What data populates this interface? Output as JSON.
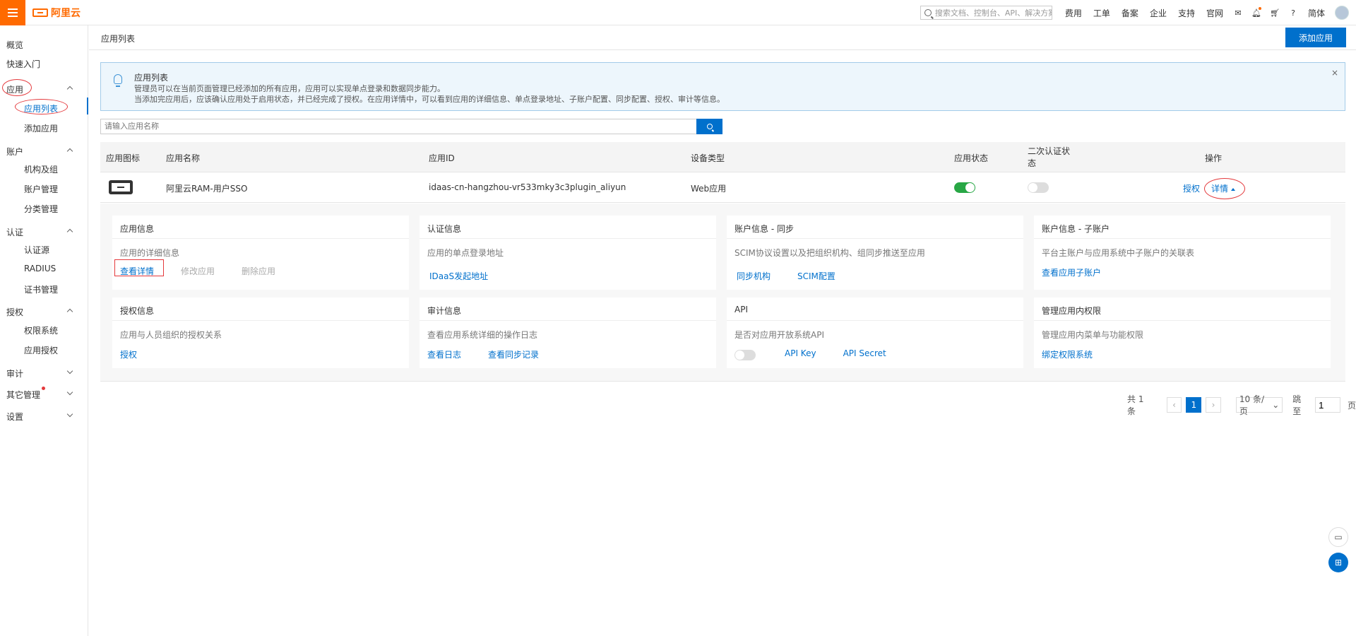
{
  "topbar": {
    "logo": "阿里云",
    "search_placeholder": "搜索文档、控制台、API、解决方案和资源",
    "links": [
      "费用",
      "工单",
      "备案",
      "企业",
      "支持",
      "官网"
    ],
    "lang": "简体"
  },
  "sidebar": {
    "overview": "概览",
    "quickstart": "快速入门",
    "app": "应用",
    "app_list": "应用列表",
    "add_app": "添加应用",
    "account": "账户",
    "org": "机构及组",
    "account_mgmt": "账户管理",
    "category_mgmt": "分类管理",
    "auth": "认证",
    "auth_source": "认证源",
    "radius": "RADIUS",
    "cert_mgmt": "证书管理",
    "authorize": "授权",
    "perm_system": "权限系统",
    "app_authorize": "应用授权",
    "audit": "审计",
    "other_mgmt": "其它管理",
    "settings": "设置"
  },
  "header": {
    "title": "应用列表",
    "add_button": "添加应用"
  },
  "notice": {
    "title": "应用列表",
    "line1": "管理员可以在当前页面管理已经添加的所有应用，应用可以实现单点登录和数据同步能力。",
    "line2": "当添加完应用后，应该确认应用处于启用状态，并已经完成了授权。在应用详情中，可以看到应用的详细信息、单点登录地址、子账户配置、同步配置、授权、审计等信息。",
    "close": "×"
  },
  "filter": {
    "placeholder": "请输入应用名称"
  },
  "table": {
    "headers": {
      "icon": "应用图标",
      "name": "应用名称",
      "id": "应用ID",
      "device": "设备类型",
      "status": "应用状态",
      "mfa_line1": "二次认证状",
      "mfa_line2": "态",
      "ops": "操作"
    },
    "row": {
      "name": "阿里云RAM-用户SSO",
      "id": "idaas-cn-hangzhou-vr533mky3c3plugin_aliyun",
      "device": "Web应用",
      "status_on": true,
      "mfa_on": false,
      "op_authorize": "授权",
      "op_detail": "详情"
    }
  },
  "cards": [
    {
      "title": "应用信息",
      "desc": "应用的详细信息",
      "links": [
        "查看详情",
        "修改应用",
        "删除应用"
      ]
    },
    {
      "title": "认证信息",
      "desc": "应用的单点登录地址",
      "links": [
        "IDaaS发起地址"
      ]
    },
    {
      "title": "账户信息 - 同步",
      "desc": "SCIM协议设置以及把组织机构、组同步推送至应用",
      "links": [
        "同步机构",
        "SCIM配置"
      ]
    },
    {
      "title": "账户信息 - 子账户",
      "desc": "平台主账户与应用系统中子账户的关联表",
      "links": [
        "查看应用子账户"
      ]
    },
    {
      "title": "授权信息",
      "desc": "应用与人员组织的授权关系",
      "links": [
        "授权"
      ]
    },
    {
      "title": "审计信息",
      "desc": "查看应用系统详细的操作日志",
      "links": [
        "查看日志",
        "查看同步记录"
      ]
    },
    {
      "title": "API",
      "desc": "是否对应用开放系统API",
      "links": [
        "API Key",
        "API Secret"
      ]
    },
    {
      "title": "管理应用内权限",
      "desc": "管理应用内菜单与功能权限",
      "links": [
        "绑定权限系统"
      ]
    }
  ],
  "pager": {
    "total": "共 1 条",
    "current": "1",
    "page_size": "10 条/页",
    "jump_label": "跳至",
    "jump_value": "1",
    "page_unit": "页"
  }
}
